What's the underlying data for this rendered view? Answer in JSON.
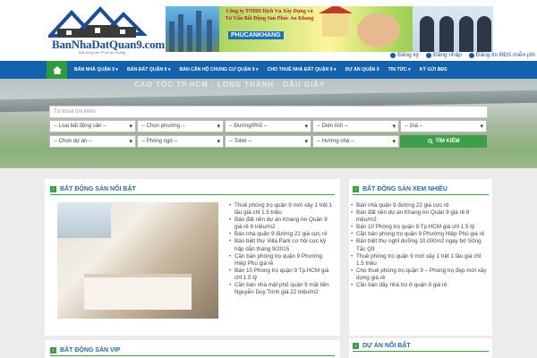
{
  "logo": {
    "text": "BanNhaDatQuan9.com",
    "tagline": "Bất động sản Phúc An Khang"
  },
  "banner": {
    "title": "Công ty TNHH Dịch Vụ Xây Dựng và Tư Vấn Bất Động Sản Phúc An Khang",
    "brand": "PHUCANKHANG"
  },
  "top_links": [
    "Đăng ký",
    "Đăng nhập",
    "Đăng tin BĐS miễn phí"
  ],
  "nav": {
    "home_icon": "home-icon",
    "items": [
      "BÁN NHÀ QUẬN 9 ▾",
      "BÁN ĐẤT QUẬN 9 ▾",
      "BÁN CĂN HỘ CHUNG CƯ QUẬN 9 ▾",
      "CHO THUÊ NHÀ ĐẤT QUẬN 9 ▾",
      "DỰ ÁN QUẬN 9",
      "TIN TỨC ▾",
      "KÝ GỬI BĐS"
    ]
  },
  "hero": {
    "sign_text": "CAO TỐC TP.HCM - LONG THÀNH - DẦU GIÂY"
  },
  "search": {
    "placeholder": "Từ khóa tìm kiếm",
    "row1": [
      "-- Loại bất động sản --",
      "-- Chọn phường --",
      "-- Đường/Phố --",
      "-- Diện tích --",
      "-- Giá --"
    ],
    "row2": [
      "-- Chọn dự án --",
      "-- Phòng ngủ --",
      "-- Toilet --",
      "-- Hướng nhà --"
    ],
    "button": "TÌM KIẾM"
  },
  "featured": {
    "title": "BẤT ĐỘNG SẢN NỔI BẬT",
    "items": [
      "Thuê phòng trọ quận 9 mới xây 1 trệt 1 lầu giá chỉ 1.5 triệu",
      "Bán đất nền dự án Khang An Quận 9 giá rẻ 8 triệu/m2",
      "Bán nhà quận 9 đường 22 giá cực rẻ",
      "Bán biệt thự Villa Park cơ hội cực kỳ hấp dẫn tháng 9/2015",
      "Cần bán phòng trọ quận 9 Phường Hiệp Phú giá rẻ",
      "Bán 10 Phòng trọ quận 9 Tp.HCM giá chỉ 1.5 tỷ",
      "Cần bán nhà mặt phố quận 9 mặt tiền Nguyễn Duy Trinh giá 22 triệu/m2"
    ]
  },
  "most_viewed": {
    "title": "BẤT ĐỘNG SẢN XEM NHIỀU",
    "items": [
      "Bán nhà quận 9 đường 22 giá cực rẻ",
      "Bán đất nền dự án Khang An Quận 9 giá rẻ 8 triệu/m2",
      "Bán 10 Phòng trọ quận 9 Tp.HCM giá chỉ 1.5 tỷ",
      "Cần bán phòng trọ quận 9 Phường Hiệp Phú giá rẻ",
      "Bán biệt thự nghỉ dưỡng 10.000m2 ngay bờ Sông Tắc Q9",
      "Thuê phòng trọ quận 9 mới xây 1 trệt 1 lầu giá chỉ 1.5 triệu",
      "Cho thuê phòng trọ quận 9 – Phòng trọ đẹp mới xây dựng giá rẻ",
      "Cần bán dãy nhà trọ ở quận 9 giá rẻ"
    ]
  },
  "vip": {
    "title": "BẤT ĐỘNG SẢN VIP"
  },
  "projects": {
    "title": "DỰ ÁN NỔI BẬT"
  },
  "colors": {
    "nav": "#1462ad",
    "accent_green": "#3c9e49",
    "link_blue": "#2b6aa6"
  }
}
